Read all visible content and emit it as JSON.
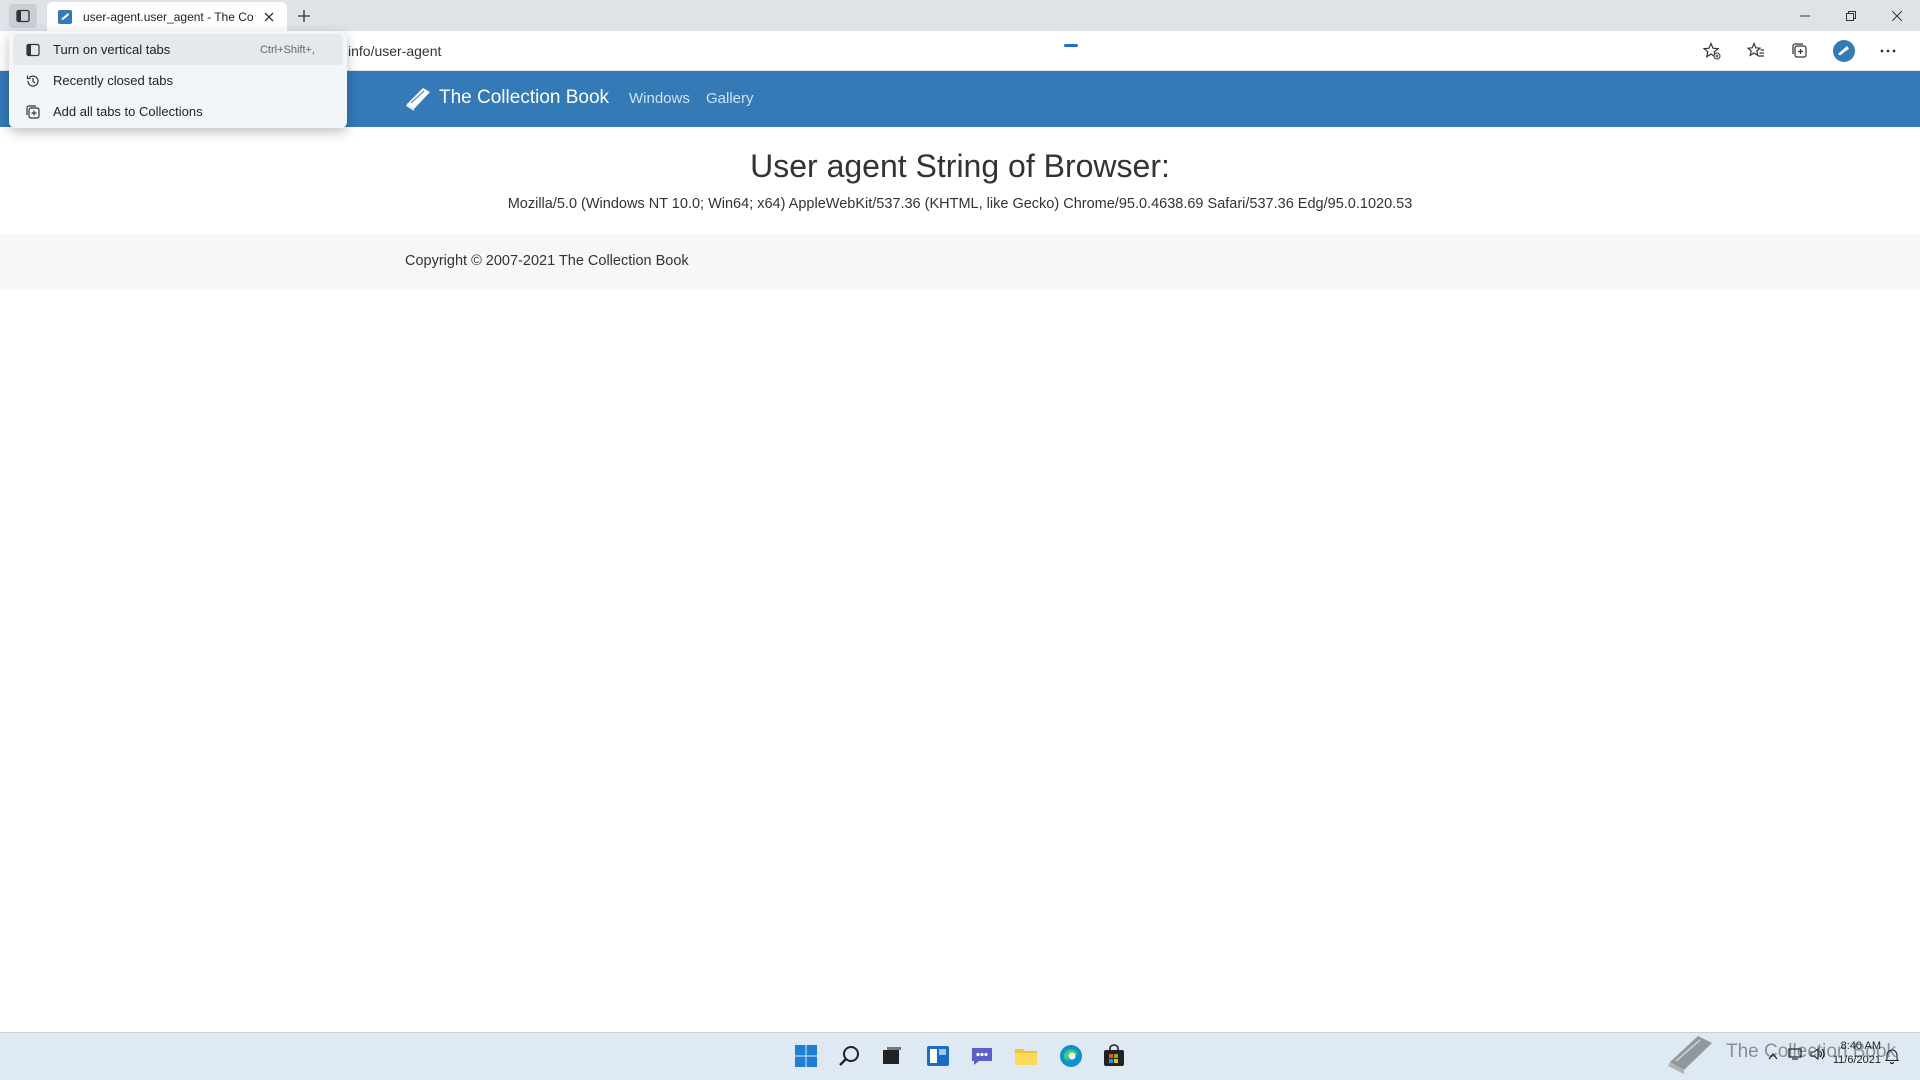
{
  "tab": {
    "title": "user-agent.user_agent - The Collection Book"
  },
  "toolbar": {
    "address": "info/user-agent"
  },
  "tab_menu": {
    "items": [
      {
        "label": "Turn on vertical tabs",
        "shortcut": "Ctrl+Shift+,",
        "icon": "vertical-tabs-icon"
      },
      {
        "label": "Recently closed tabs",
        "icon": "history-icon"
      },
      {
        "label": "Add all tabs to Collections",
        "icon": "collections-icon"
      }
    ]
  },
  "site": {
    "brand": "The Collection Book",
    "nav": [
      "Windows",
      "Gallery"
    ],
    "heading": "User agent String of Browser:",
    "user_agent": "Mozilla/5.0 (Windows NT 10.0; Win64; x64) AppleWebKit/537.36 (KHTML, like Gecko) Chrome/95.0.4638.69 Safari/537.36 Edg/95.0.1020.53",
    "footer": "Copyright © 2007-2021 The Collection Book"
  },
  "taskbar": {
    "watermark": "The Collection Book",
    "time": "8:40 AM",
    "date": "11/6/2021"
  },
  "colors": {
    "nav_bg": "#337ab7",
    "tabstrip_bg": "#dfe3e8",
    "taskbar_bg": "#dfe9f3"
  }
}
